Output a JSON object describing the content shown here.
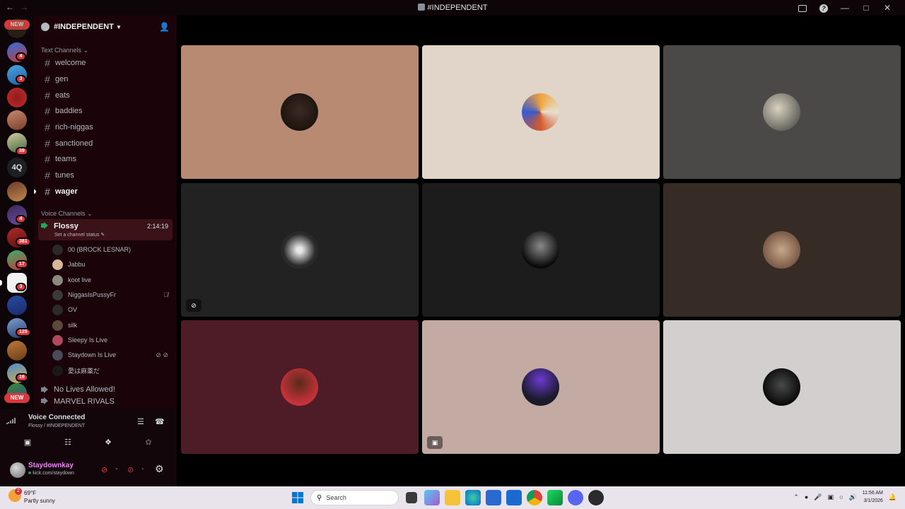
{
  "window": {
    "title": "#INDEPENDENT",
    "back_icon": "arrow-left",
    "forward_icon": "arrow-right"
  },
  "rail": {
    "new_label": "NEW",
    "text_server": "4Q",
    "badges": [
      "4",
      "3",
      "39",
      "4",
      "381",
      "17",
      "3",
      "125",
      "16"
    ]
  },
  "guild": {
    "name": "#INDEPENDENT",
    "text_category": "Text Channels",
    "voice_category": "Voice Channels",
    "text_channels": [
      "welcome",
      "gen",
      "eats",
      "baddies",
      "rich-niggas",
      "sanctioned",
      "teams",
      "tunes",
      "wager"
    ],
    "active_voice": {
      "name": "Flossy",
      "timer": "2:14:19",
      "status": "Set a channel status"
    },
    "voice_users": [
      "00 (BROCK LESNAR)",
      "Jabbu",
      "koot live",
      "NiggasIsPussyFr",
      "OV",
      "silk",
      "Sleepy Is Live",
      "Staydown Is Live",
      "愛は麻薬だ"
    ],
    "other_voice": [
      "No Lives Allowed!",
      "MARVEL RIVALS"
    ]
  },
  "voice_panel": {
    "title": "Voice Connected",
    "subtitle": "Flossy / #INDEPENDENT"
  },
  "user": {
    "name": "Staydownkay",
    "status": "kick.com/staydown"
  },
  "taskbar": {
    "temp": "69°F",
    "weather": "Partly sunny",
    "weather_badge": "2",
    "search_placeholder": "Search",
    "time": "11:56 AM",
    "date": "3/1/2026"
  },
  "colors": {
    "accent_red": "#da373c",
    "voice_green": "#23a55a",
    "username_pink": "#f47fff",
    "tiles": [
      "#b98a72",
      "#e1d4c9",
      "#4a4947",
      "#222222",
      "#1c1c1c",
      "#362b25",
      "#4e1c26",
      "#c3aaa2",
      "#d4cfcf"
    ]
  }
}
